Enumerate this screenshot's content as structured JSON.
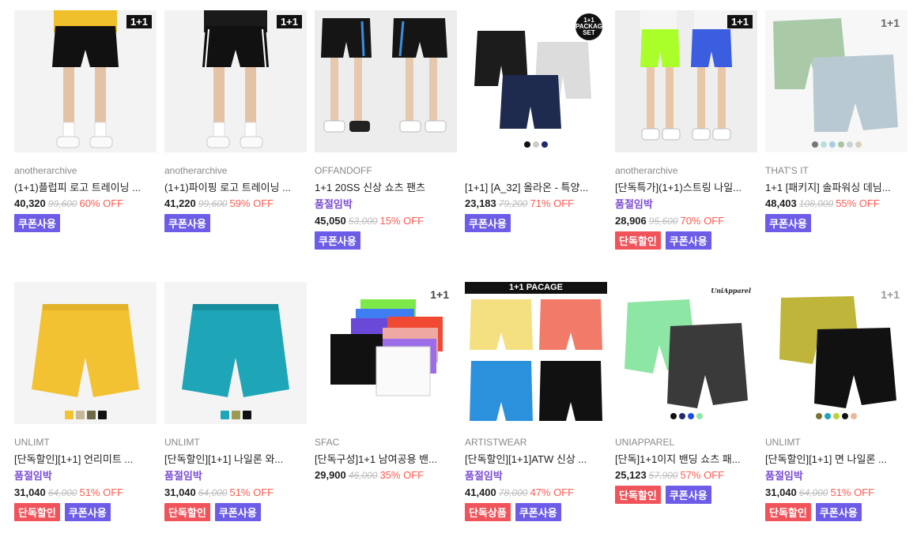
{
  "products": [
    {
      "brand": "anotherarchive",
      "name": "(1+1)플럽피 로고 트레이닝 ...",
      "status": "",
      "price": "40,320",
      "orig": "99,600",
      "off": "60% OFF",
      "badges": [
        "쿠폰사용"
      ],
      "tag": "1+1"
    },
    {
      "brand": "anotherarchive",
      "name": "(1+1)파이핑 로고 트레이닝 ...",
      "status": "",
      "price": "41,220",
      "orig": "99,600",
      "off": "59% OFF",
      "badges": [
        "쿠폰사용"
      ],
      "tag": "1+1"
    },
    {
      "brand": "OFFANDOFF",
      "name": "1+1 20SS 신상 쇼츠 팬츠",
      "status": "품절임박",
      "price": "45,050",
      "orig": "53,000",
      "off": "15% OFF",
      "badges": [
        "쿠폰사용"
      ],
      "tag": ""
    },
    {
      "brand": "",
      "name": "[1+1] [A_32] 올라온 - 특양...",
      "status": "",
      "price": "23,183",
      "orig": "79,200",
      "off": "71% OFF",
      "badges": [
        "쿠폰사용"
      ],
      "tag": "1+1 PACKAGE SET"
    },
    {
      "brand": "anotherarchive",
      "name": "[단독특가](1+1)스트링 나일...",
      "status": "품절임박",
      "price": "28,906",
      "orig": "95,600",
      "off": "70% OFF",
      "badges": [
        "단독할인",
        "쿠폰사용"
      ],
      "tag": "1+1"
    },
    {
      "brand": "THAT'S IT",
      "name": "1+1 [패키지] 솔파워싱 데님...",
      "status": "",
      "price": "48,403",
      "orig": "108,000",
      "off": "55% OFF",
      "badges": [
        "쿠폰사용"
      ],
      "tag": "1+1"
    },
    {
      "brand": "UNLIMT",
      "name": "[단독할인][1+1] 언리미트 ...",
      "status": "품절임박",
      "price": "31,040",
      "orig": "64,000",
      "off": "51% OFF",
      "badges": [
        "단독할인",
        "쿠폰사용"
      ],
      "tag": ""
    },
    {
      "brand": "UNLIMT",
      "name": "[단독할인][1+1] 나일론 와...",
      "status": "품절임박",
      "price": "31,040",
      "orig": "64,000",
      "off": "51% OFF",
      "badges": [
        "단독할인",
        "쿠폰사용"
      ],
      "tag": ""
    },
    {
      "brand": "SFAC",
      "name": "[단독구성]1+1 남여공용 밴...",
      "status": "",
      "price": "29,900",
      "orig": "46,000",
      "off": "35% OFF",
      "badges": [],
      "tag": "1+1"
    },
    {
      "brand": "ARTISTWEAR",
      "name": "[단독할인][1+1]ATW 신상 ...",
      "status": "품절임박",
      "price": "41,400",
      "orig": "78,000",
      "off": "47% OFF",
      "badges": [
        "단독상품",
        "쿠폰사용"
      ],
      "tag": "1+1 PACAGE"
    },
    {
      "brand": "UNIAPPAREL",
      "name": "[단독]1+1이지 밴딩 쇼츠 패...",
      "status": "",
      "price": "25,123",
      "orig": "57,900",
      "off": "57% OFF",
      "badges": [
        "단독할인",
        "쿠폰사용"
      ],
      "tag": "UniApparel"
    },
    {
      "brand": "UNLIMT",
      "name": "[단독할인][1+1] 면 나일론 ...",
      "status": "품절임박",
      "price": "31,040",
      "orig": "64,000",
      "off": "51% OFF",
      "badges": [
        "단독할인",
        "쿠폰사용"
      ],
      "tag": "1+1"
    }
  ],
  "colors": {
    "coupon": "#6c5ce7",
    "exclusive": "#f0545a",
    "discount": "#ff5a4f",
    "soldout": "#7b4dd4"
  }
}
